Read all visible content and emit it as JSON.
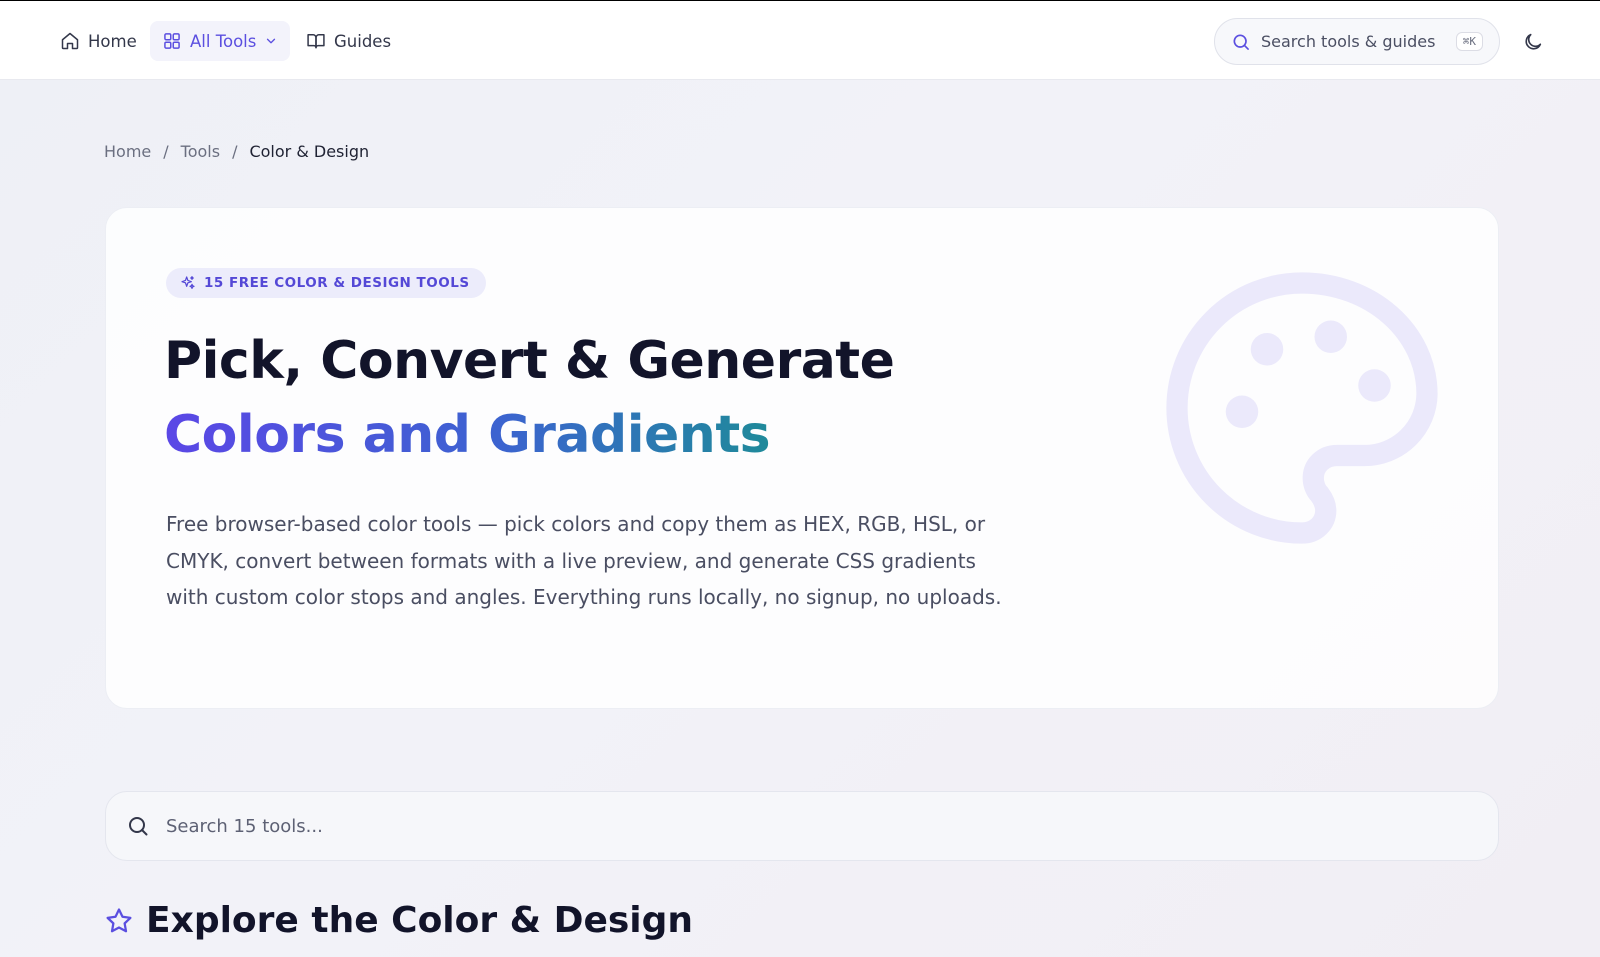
{
  "nav": {
    "home": "Home",
    "all_tools": "All Tools",
    "guides": "Guides",
    "search_label": "Search tools & guides",
    "shortcut": "⌘K"
  },
  "breadcrumb": {
    "items": [
      "Home",
      "Tools",
      "Color & Design"
    ]
  },
  "hero": {
    "badge": "15 FREE COLOR & DESIGN TOOLS",
    "title_line1": "Pick, Convert & Generate",
    "title_line2": "Colors and Gradients",
    "description": "Free browser-based color tools — pick colors and copy them as HEX, RGB, HSL, or CMYK, convert between formats with a live preview, and generate CSS gradients with custom color stops and angles. Everything runs locally, no signup, no uploads."
  },
  "tool_search": {
    "placeholder": "Search 15 tools..."
  },
  "section": {
    "title": "Explore the Color & Design"
  },
  "colors": {
    "accent": "#5b4fe0",
    "gradient_start": "#5b47e6",
    "gradient_end": "#1f8a9a",
    "palette_icon": "#ebe9fb"
  },
  "icons": {
    "home": "home-icon",
    "tools": "grid-icon",
    "guides": "book-open-icon",
    "search": "search-icon",
    "theme": "moon-icon",
    "badge": "sparkles-icon",
    "hero": "palette-icon",
    "section": "star-icon"
  }
}
